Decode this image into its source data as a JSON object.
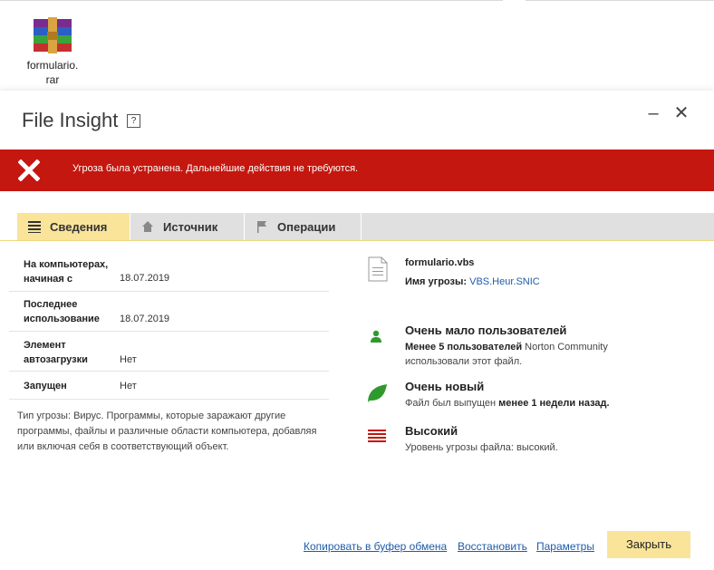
{
  "desktop": {
    "file_label_line1": "formulario.",
    "file_label_line2": "rar",
    "icon": "winrar-archive-icon"
  },
  "window": {
    "title": "File Insight",
    "help": "?",
    "minimize": "–",
    "close": "✕"
  },
  "banner": {
    "color": "#c4170f",
    "icon": "red-x-icon",
    "text": "Угроза была устранена. Дальнейшие действия не требуются."
  },
  "tabs": [
    {
      "label": "Сведения",
      "icon": "list-icon",
      "active": true
    },
    {
      "label": "Источник",
      "icon": "home-icon",
      "active": false
    },
    {
      "label": "Операции",
      "icon": "flag-icon",
      "active": false
    }
  ],
  "details": [
    {
      "label_line1": "На компьютерах,",
      "label_line2": "начиная с",
      "value": "18.07.2019"
    },
    {
      "label_line1": "Последнее",
      "label_line2": "использование",
      "value": "18.07.2019"
    },
    {
      "label_line1": "Элемент",
      "label_line2": "автозагрузки",
      "value": "Нет"
    },
    {
      "label_line1": "Запущен",
      "label_line2": "",
      "value": "Нет"
    }
  ],
  "threat_description_line1": "Тип угрозы: Вирус. Программы, которые заражают другие",
  "threat_description_line2": "программы, файлы и различные области компьютера, добавляя",
  "threat_description_line3": "или включая себя в соответствующий объект.",
  "file": {
    "name": "formulario.vbs",
    "threat_label": "Имя угрозы:",
    "threat_name": "VBS.Heur.SNIC"
  },
  "insights": {
    "users": {
      "title": "Очень мало пользователей",
      "line1_bold": "Менее 5 пользователей",
      "line1_rest": " Norton Community",
      "line2": "использовали этот файл."
    },
    "age": {
      "title": "Очень новый",
      "line1_pre": "Файл был выпущен ",
      "line1_bold": "менее 1 недели назад."
    },
    "risk": {
      "title": "Высокий",
      "line1": "Уровень угрозы файла: высокий."
    }
  },
  "footer": {
    "copy": "Копировать в буфер обмена",
    "restore": "Восстановить",
    "settings": "Параметры",
    "close": "Закрыть"
  },
  "colors": {
    "accent_yellow": "#f9e49a",
    "link": "#1f5ca8",
    "danger": "#c4170f",
    "green": "#2e9a2e"
  }
}
